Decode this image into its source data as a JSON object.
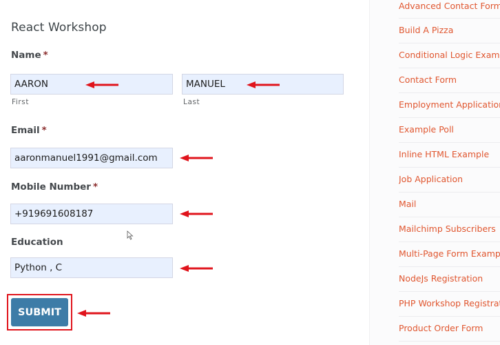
{
  "form": {
    "title": "React Workshop",
    "name_label": "Name",
    "required_mark": "*",
    "first_name_value": "AARON",
    "first_sublabel": "First",
    "last_name_value": "MANUEL",
    "last_sublabel": "Last",
    "email_label": "Email",
    "email_value": "aaronmanuel1991@gmail.com",
    "mobile_label": "Mobile Number",
    "mobile_value": "+919691608187",
    "education_label": "Education",
    "education_value": "Python , C",
    "submit_label": "SUBMIT"
  },
  "annotations": {
    "arrow_color": "#e0141c",
    "highlight_color": "#e0141c"
  },
  "colors": {
    "accent_button": "#3d7ca7",
    "link": "#e0562f",
    "input_bg": "#e8f0fe"
  },
  "sidebar": {
    "items": [
      {
        "label": "Advanced Contact Form"
      },
      {
        "label": "Build A Pizza"
      },
      {
        "label": "Conditional Logic Example"
      },
      {
        "label": "Contact Form"
      },
      {
        "label": "Employment Application"
      },
      {
        "label": "Example Poll"
      },
      {
        "label": "Inline HTML Example"
      },
      {
        "label": "Job Application"
      },
      {
        "label": "Mail"
      },
      {
        "label": "Mailchimp Subscribers"
      },
      {
        "label": "Multi-Page Form Example"
      },
      {
        "label": "NodeJs Registration"
      },
      {
        "label": "PHP Workshop Registration"
      },
      {
        "label": "Product Order Form"
      }
    ]
  }
}
